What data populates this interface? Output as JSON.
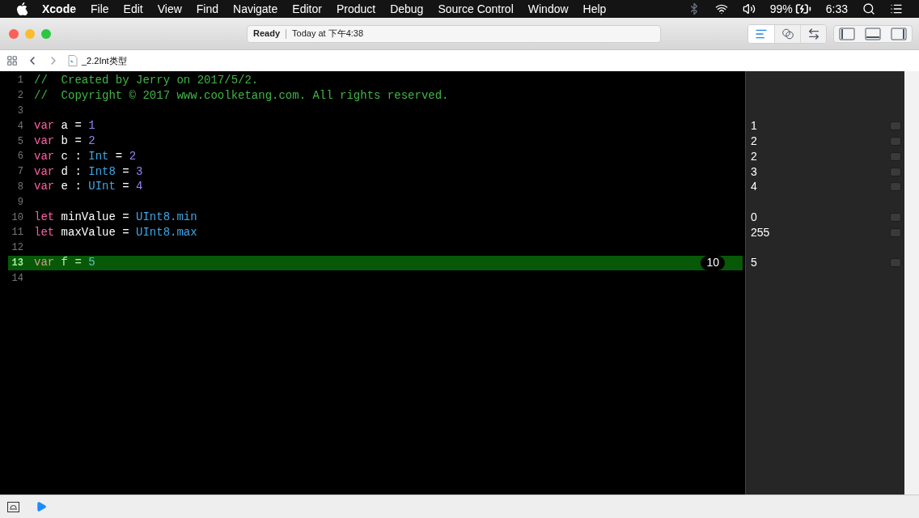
{
  "menu_bar": {
    "app": "Xcode",
    "items": [
      "File",
      "Edit",
      "View",
      "Find",
      "Navigate",
      "Editor",
      "Product",
      "Debug",
      "Source Control",
      "Window",
      "Help"
    ],
    "battery": "99%",
    "clock": "6:33"
  },
  "toolbar": {
    "status": "Ready",
    "activity": "Today at 下午4:38",
    "editor_modes": [
      {
        "kind": "standard",
        "selected": true
      },
      {
        "kind": "assistant",
        "selected": false
      },
      {
        "kind": "version",
        "selected": false
      }
    ]
  },
  "jump_bar": {
    "file": "_2.2Int类型"
  },
  "editor": {
    "lines": [
      {
        "number": "1",
        "selected": false,
        "tokens": [
          {
            "text": "//  Created by Jerry on 2017/5/2.",
            "kind": "comment"
          }
        ]
      },
      {
        "number": "2",
        "selected": false,
        "tokens": [
          {
            "text": "//  Copyright © 2017 www.coolketang.com. All rights reserved.",
            "kind": "comment"
          }
        ]
      },
      {
        "number": "3",
        "selected": false
      },
      {
        "number": "4",
        "selected": false,
        "result": "1",
        "tokens": [
          {
            "text": "var",
            "kind": "keyword"
          },
          {
            "text": " a = ",
            "kind": "plain"
          },
          {
            "text": "1",
            "kind": "number"
          }
        ]
      },
      {
        "number": "5",
        "selected": false,
        "result": "2",
        "tokens": [
          {
            "text": "var",
            "kind": "keyword"
          },
          {
            "text": " b = ",
            "kind": "plain"
          },
          {
            "text": "2",
            "kind": "number"
          }
        ]
      },
      {
        "number": "6",
        "selected": false,
        "result": "2",
        "tokens": [
          {
            "text": "var",
            "kind": "keyword"
          },
          {
            "text": " c : ",
            "kind": "plain"
          },
          {
            "text": "Int",
            "kind": "type"
          },
          {
            "text": " = ",
            "kind": "plain"
          },
          {
            "text": "2",
            "kind": "number"
          }
        ]
      },
      {
        "number": "7",
        "selected": false,
        "result": "3",
        "tokens": [
          {
            "text": "var",
            "kind": "keyword"
          },
          {
            "text": " d : ",
            "kind": "plain"
          },
          {
            "text": "Int8",
            "kind": "type"
          },
          {
            "text": " = ",
            "kind": "plain"
          },
          {
            "text": "3",
            "kind": "number"
          }
        ]
      },
      {
        "number": "8",
        "selected": false,
        "result": "4",
        "tokens": [
          {
            "text": "var",
            "kind": "keyword"
          },
          {
            "text": " e : ",
            "kind": "plain"
          },
          {
            "text": "UInt",
            "kind": "type"
          },
          {
            "text": " = ",
            "kind": "plain"
          },
          {
            "text": "4",
            "kind": "number"
          }
        ]
      },
      {
        "number": "9",
        "selected": false
      },
      {
        "number": "10",
        "selected": false,
        "result": "0",
        "tokens": [
          {
            "text": "let",
            "kind": "keyword"
          },
          {
            "text": " minValue = ",
            "kind": "plain"
          },
          {
            "text": "UInt8",
            "kind": "type"
          },
          {
            "text": ".min",
            "kind": "type"
          }
        ]
      },
      {
        "number": "11",
        "selected": false,
        "result": "255",
        "tokens": [
          {
            "text": "let",
            "kind": "keyword"
          },
          {
            "text": " maxValue = ",
            "kind": "plain"
          },
          {
            "text": "UInt8",
            "kind": "type"
          },
          {
            "text": ".max",
            "kind": "type"
          }
        ]
      },
      {
        "number": "12",
        "selected": false
      },
      {
        "number": "13",
        "selected": true,
        "result": "5",
        "badge": "10",
        "tokens": [
          {
            "text": "var",
            "kind": "keyword"
          },
          {
            "text": " f = ",
            "kind": "plain"
          },
          {
            "text": "5",
            "kind": "number"
          }
        ]
      },
      {
        "number": "14",
        "selected": false
      }
    ]
  }
}
